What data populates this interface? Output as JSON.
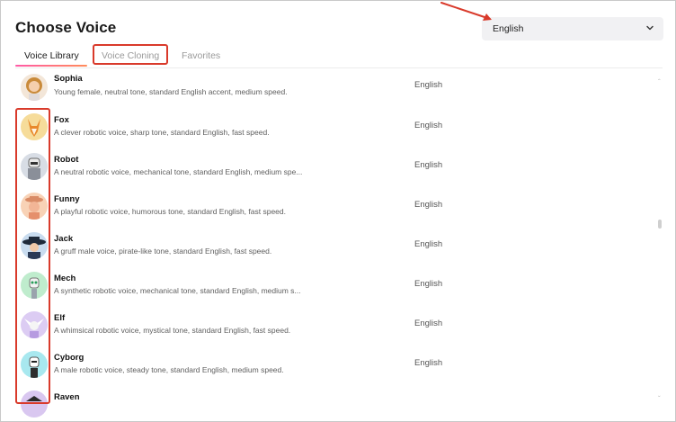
{
  "header": {
    "title": "Choose Voice"
  },
  "language_select": {
    "value": "English",
    "icon": "chevron-down-icon"
  },
  "tabs": [
    {
      "label": "Voice Library",
      "active": true
    },
    {
      "label": "Voice Cloning",
      "active": false
    },
    {
      "label": "Favorites",
      "active": false
    }
  ],
  "voices": [
    {
      "name": "Sophia",
      "description": "Young female, neutral tone, standard English accent, medium speed.",
      "language": "English",
      "avatar_icon": "woman-avatar-icon"
    },
    {
      "name": "Fox",
      "description": "A clever robotic voice, sharp tone, standard English, fast speed.",
      "language": "English",
      "avatar_icon": "fox-avatar-icon"
    },
    {
      "name": "Robot",
      "description": "A neutral robotic voice, mechanical tone, standard English, medium spe...",
      "language": "English",
      "avatar_icon": "robot-avatar-icon"
    },
    {
      "name": "Funny",
      "description": "A playful robotic voice, humorous tone, standard English, fast speed.",
      "language": "English",
      "avatar_icon": "funny-avatar-icon"
    },
    {
      "name": "Jack",
      "description": "A gruff male voice, pirate-like tone, standard English, fast speed.",
      "language": "English",
      "avatar_icon": "pirate-avatar-icon"
    },
    {
      "name": "Mech",
      "description": "A synthetic robotic voice, mechanical tone, standard English, medium s...",
      "language": "English",
      "avatar_icon": "mech-avatar-icon"
    },
    {
      "name": "Elf",
      "description": "A whimsical robotic voice, mystical tone, standard English, fast speed.",
      "language": "English",
      "avatar_icon": "elf-avatar-icon"
    },
    {
      "name": "Cyborg",
      "description": "A male robotic voice, steady tone, standard English, medium speed.",
      "language": "English",
      "avatar_icon": "cyborg-avatar-icon"
    },
    {
      "name": "Raven",
      "description": "",
      "language": "",
      "avatar_icon": "raven-avatar-icon"
    }
  ],
  "colors": {
    "annotation": "#d93a2b",
    "tab_accent": "#ff5aa7",
    "select_bg": "#f1f1f3"
  }
}
